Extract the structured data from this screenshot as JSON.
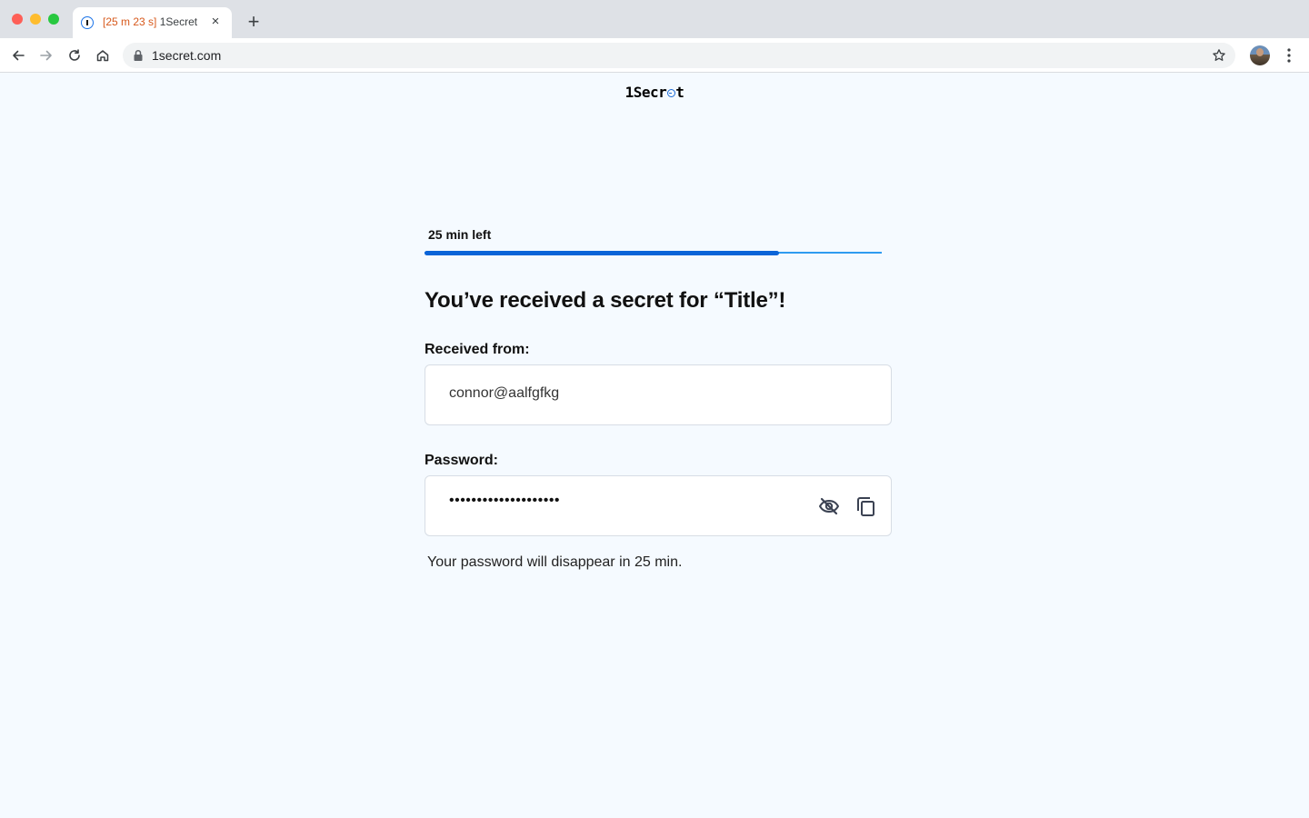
{
  "browser": {
    "tab": {
      "timer": "[25 m 23 s]",
      "title": "1Secret",
      "close": "×"
    },
    "new_tab": "+",
    "url": "1secret.com"
  },
  "page": {
    "logo": {
      "prefix": "1Secr",
      "suffix": "t"
    },
    "time_left_label": "25 min left",
    "progress_fraction": 0.775,
    "heading": "You’ve received a secret for “Title”!",
    "received_from": {
      "label": "Received from:",
      "value": "connor@aalfgfkg"
    },
    "password": {
      "label": "Password:",
      "masked_value": "••••••••••••••••••••"
    },
    "note": "Your password will disappear in 25 min."
  },
  "colors": {
    "accent": "#0a64d8",
    "track": "#2f9bf0",
    "page_bg": "#f5faff",
    "tab_timer": "#d7591c"
  },
  "icons": {
    "reveal": "eye-off-icon",
    "copy": "copy-icon",
    "back": "arrow-left-icon",
    "forward": "arrow-right-icon",
    "reload": "reload-icon",
    "home": "home-icon",
    "secure": "lock-icon",
    "bookmark": "star-icon",
    "menu": "kebab-menu-icon"
  }
}
